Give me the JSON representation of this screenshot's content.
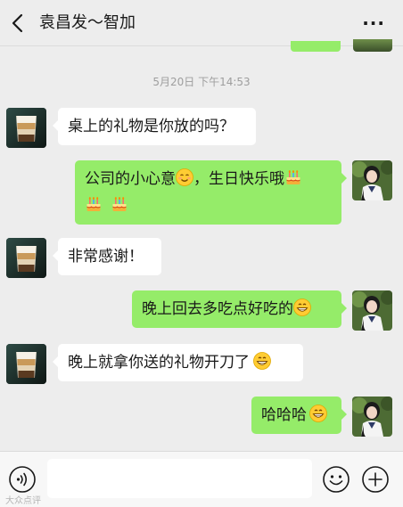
{
  "header": {
    "title": "袁昌发～智加",
    "more_label": "···",
    "back_icon": "chevron-left-icon"
  },
  "chat": {
    "timestamp": "5月20日 下午14:53",
    "colors": {
      "incoming_bubble": "#ffffff",
      "outgoing_bubble": "#95ec69",
      "background": "#ededed"
    },
    "messages": [
      {
        "side": "in",
        "parts": [
          "桌上的礼物是你放的吗？"
        ]
      },
      {
        "side": "out",
        "line1": "公司的小心意",
        "line1b": "，生日快乐哦",
        "emojis": [
          "smiling-face-emoji",
          "cake-emoji",
          "cake-emoji",
          "cake-emoji"
        ]
      },
      {
        "side": "in",
        "parts": [
          "非常感谢！"
        ]
      },
      {
        "side": "out",
        "parts": [
          "晚上回去多吃点好吃的"
        ],
        "emojis": [
          "grinning-face-emoji"
        ]
      },
      {
        "side": "in",
        "parts": [
          "晚上就拿你送的礼物开刀了"
        ],
        "emojis": [
          "grinning-face-emoji"
        ]
      },
      {
        "side": "out",
        "parts": [
          "哈哈哈"
        ],
        "emojis": [
          "grinning-face-emoji"
        ]
      }
    ]
  },
  "inputbar": {
    "input_value": "",
    "voice_icon": "voice-icon",
    "emoji_icon": "emoji-face-icon",
    "plus_icon": "plus-icon"
  },
  "watermark": "大众点评"
}
